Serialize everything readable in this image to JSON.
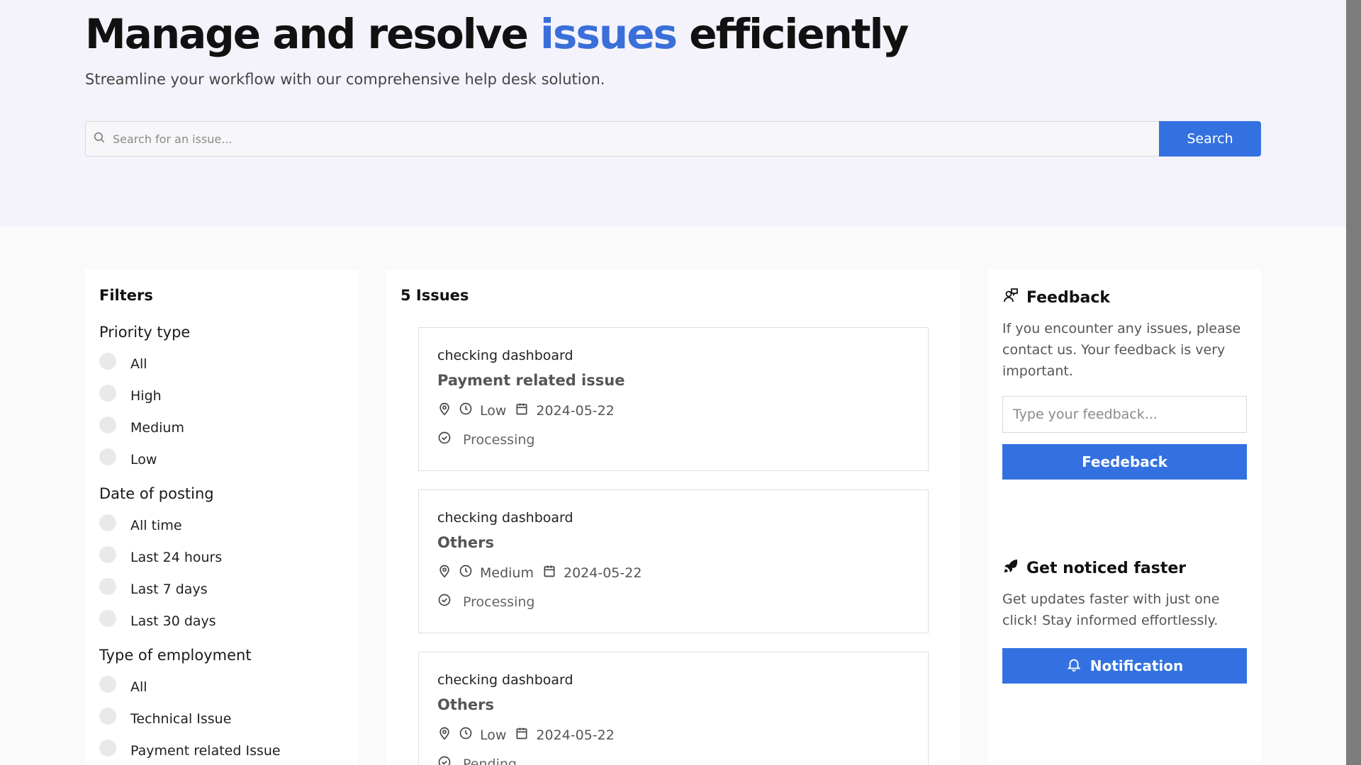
{
  "hero": {
    "title_prefix": "Manage and resolve ",
    "title_accent": "issues",
    "title_suffix": " efficiently",
    "subtitle": "Streamline your workflow with our comprehensive help desk solution.",
    "search_placeholder": "Search for an issue...",
    "search_button": "Search"
  },
  "colors": {
    "accent": "#3a6fd9",
    "button": "#3371e0",
    "hero_bg": "#f4f3fc"
  },
  "filters": {
    "title": "Filters",
    "groups": [
      {
        "title": "Priority type",
        "options": [
          "All",
          "High",
          "Medium",
          "Low"
        ]
      },
      {
        "title": "Date of posting",
        "options": [
          "All time",
          "Last 24 hours",
          "Last 7 days",
          "Last 30 days"
        ]
      },
      {
        "title": "Type of employment",
        "options": [
          "All",
          "Technical Issue",
          "Payment related Issue"
        ]
      }
    ]
  },
  "issues": {
    "count_label": "5 Issues",
    "items": [
      {
        "subtitle": "checking dashboard",
        "title": "Payment related issue",
        "priority": "Low",
        "date": "2024-05-22",
        "status": "Processing"
      },
      {
        "subtitle": "checking dashboard",
        "title": "Others",
        "priority": "Medium",
        "date": "2024-05-22",
        "status": "Processing"
      },
      {
        "subtitle": "checking dashboard",
        "title": "Others",
        "priority": "Low",
        "date": "2024-05-22",
        "status": "Pending"
      }
    ]
  },
  "feedback": {
    "title": "Feedback",
    "text": "If you encounter any issues, please contact us. Your feedback is very important.",
    "placeholder": "Type your feedback...",
    "button": "Feedeback",
    "icon": "feedback-person-icon"
  },
  "notify": {
    "title": "Get noticed faster",
    "text": "Get updates faster with just one click! Stay informed effortlessly.",
    "button": "Notification",
    "icon": "rocket-icon",
    "button_icon": "bell-icon"
  }
}
